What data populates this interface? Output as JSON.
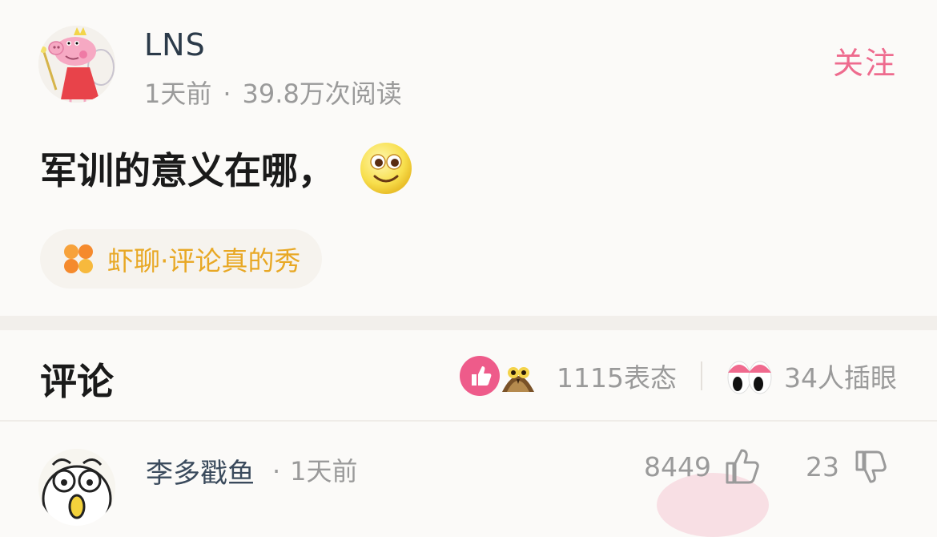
{
  "post": {
    "author": "LNS",
    "time": "1天前",
    "separator": "·",
    "views": "39.8万次阅读",
    "follow_label": "关注",
    "text": "军训的意义在哪，",
    "topic": "虾聊·评论真的秀"
  },
  "comments_header": {
    "title": "评论",
    "reactions_count": "1115表态",
    "peek_count": "34人插眼"
  },
  "first_comment": {
    "author": "李多戳鱼",
    "separator": "·",
    "time": "1天前",
    "likes": "8449",
    "dislikes": "23"
  },
  "colors": {
    "accent_pink": "#ee6b8e",
    "topic_gold": "#e8a825",
    "meta_gray": "#9a9a9a"
  },
  "icons": [
    "avatar-peppa-fairy",
    "smile-emoji",
    "clover-icon",
    "thumb-up-badge",
    "owl-badge",
    "peek-eyes-icon",
    "like-icon",
    "dislike-icon"
  ]
}
